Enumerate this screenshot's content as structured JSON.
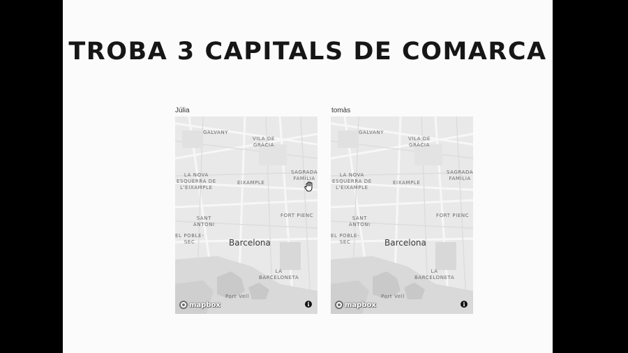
{
  "title": "TROBA 3 CAPITALS DE COMARCA",
  "players": [
    {
      "name": "Júlia",
      "map": {
        "labels": {
          "galvany": "GALVANY",
          "vila_de_gracia": [
            "VILA DE",
            "GRÀCIA"
          ],
          "sagrada_familia": [
            "SAGRADA",
            "FAMÍLIA"
          ],
          "la_nova_esquerra": [
            "LA NOVA",
            "ESQUERRA DE",
            "L'EIXAMPLE"
          ],
          "eixample": "EIXAMPLE",
          "fort_pienc": "FORT PIENC",
          "sant_antoni": [
            "SANT",
            "ANTONI"
          ],
          "el_poble_sec": [
            "EL POBLE-",
            "SEC"
          ],
          "city": "Barcelona",
          "la_barceloneta": [
            "LA",
            "BARCELONETA"
          ],
          "port_vell": "Port Vell"
        },
        "attribution_logo": "mapbox",
        "info_symbol": "i",
        "cursor_icon": "grab-hand-icon"
      }
    },
    {
      "name": "tomàs",
      "map": {
        "labels": {
          "galvany": "GALVANY",
          "vila_de_gracia": [
            "VILA DE",
            "GRÀCIA"
          ],
          "sagrada_familia": [
            "SAGRADA",
            "FAMÍLIA"
          ],
          "la_nova_esquerra": [
            "LA NOVA",
            "ESQUERRA DE",
            "L'EIXAMPLE"
          ],
          "eixample": "EIXAMPLE",
          "fort_pienc": "FORT PIENC",
          "sant_antoni": [
            "SANT",
            "ANTONI"
          ],
          "el_poble_sec": [
            "EL POBLE-",
            "SEC"
          ],
          "city": "Barcelona",
          "la_barceloneta": [
            "LA",
            "BARCELONETA"
          ],
          "port_vell": "Port Vell"
        },
        "attribution_logo": "mapbox",
        "info_symbol": "i"
      }
    }
  ],
  "colors": {
    "background": "#fbfbfb",
    "letterbox": "#000000",
    "map_land": "#e9e9e9",
    "title": "#161616"
  }
}
